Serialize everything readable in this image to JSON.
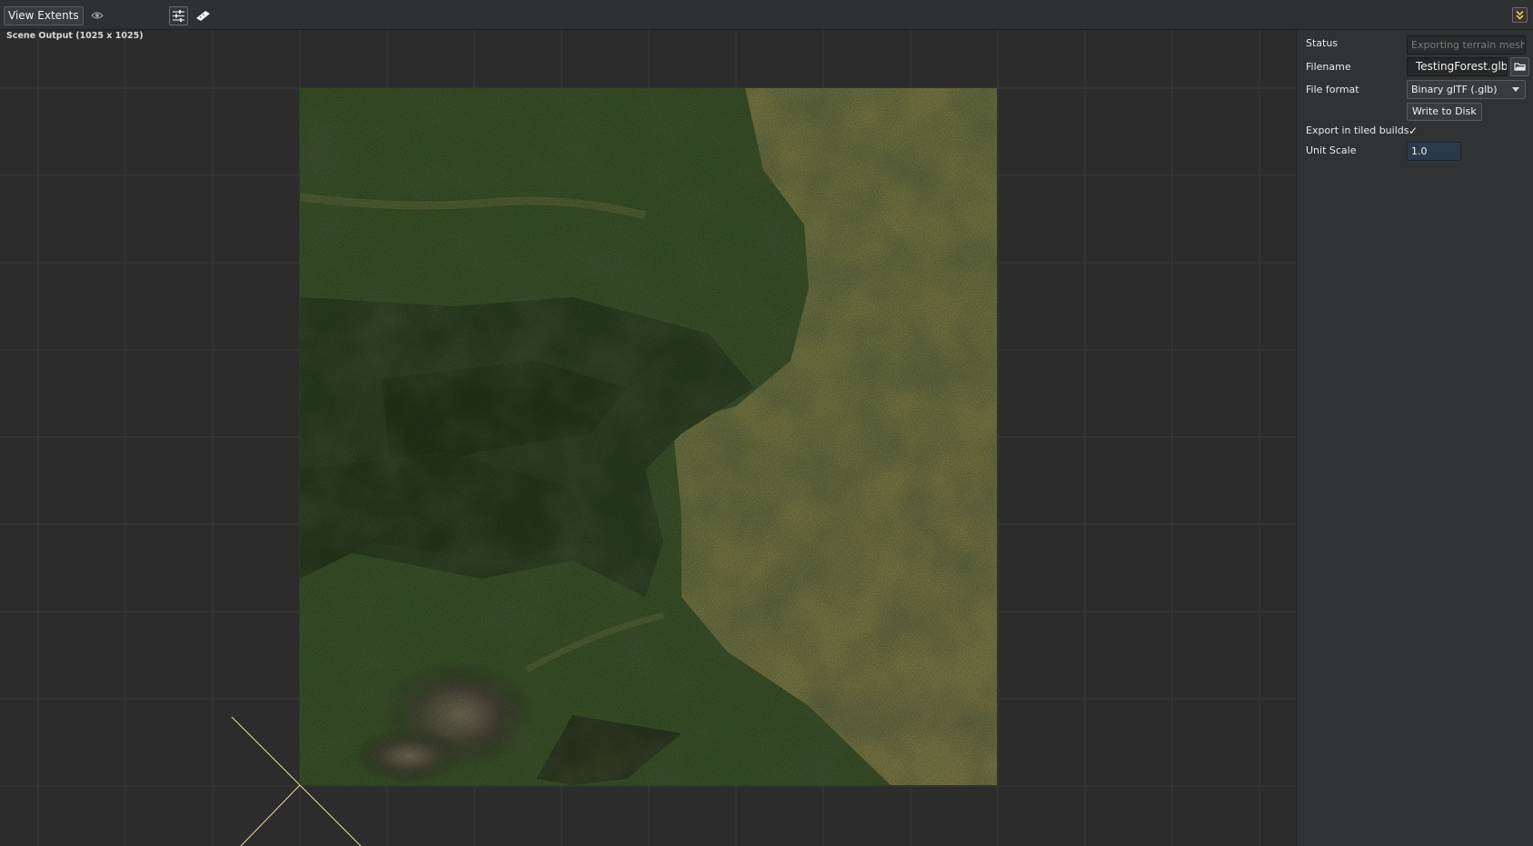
{
  "toolbar": {
    "view_extents_label": "View Extents",
    "eye_icon": "eye-icon",
    "sliders_icon": "sliders-icon",
    "ruler_icon": "ruler-icon",
    "collapse_icon": "double-chevron-down-icon"
  },
  "viewport": {
    "title": "Scene Output (1025 x 1025)",
    "grid_color": "#3a3a3a",
    "axis_color": "#e8e08a"
  },
  "properties": {
    "status_label": "Status",
    "status_value": "Exporting terrain mesh",
    "filename_label": "Filename",
    "filename_value": "TestingForest.glb",
    "browse_icon": "folder-open-icon",
    "file_format_label": "File format",
    "file_format_value": "Binary glTF (.glb)",
    "write_button_label": "Write to Disk",
    "tiled_label": "Export in tiled builds",
    "tiled_checked": "✓",
    "unit_scale_label": "Unit Scale",
    "unit_scale_value": "1.0"
  }
}
